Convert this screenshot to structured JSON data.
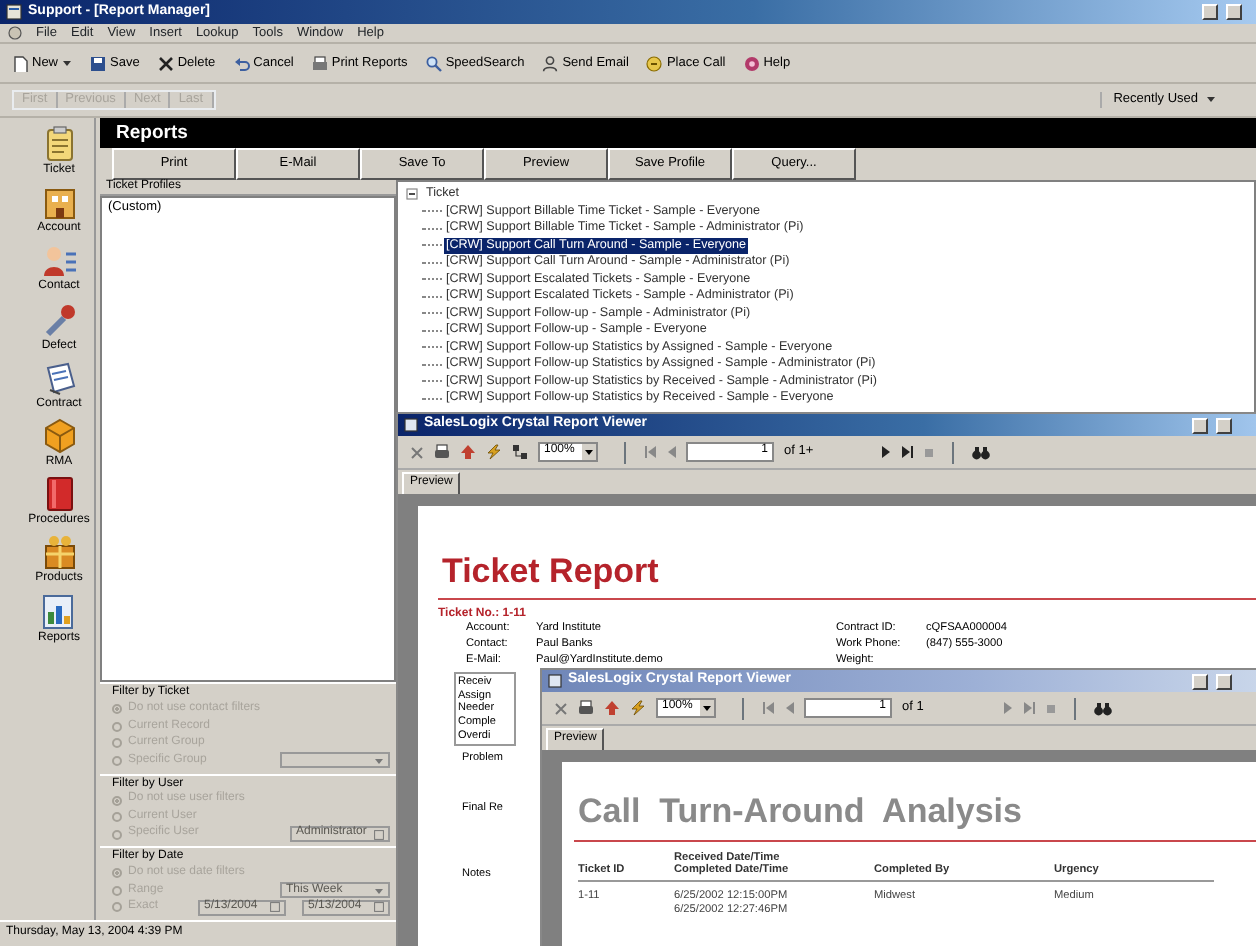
{
  "window": {
    "title": "Support - [Report Manager]"
  },
  "menu": [
    "File",
    "Edit",
    "View",
    "Insert",
    "Lookup",
    "Tools",
    "Window",
    "Help"
  ],
  "toolbar": [
    {
      "label": "New",
      "kind": "new",
      "dropdown": true
    },
    {
      "label": "Save",
      "kind": "save",
      "dropdown": false
    },
    {
      "label": "Delete",
      "kind": "delete",
      "dropdown": false
    },
    {
      "label": "Cancel",
      "kind": "cancel",
      "dropdown": false
    },
    {
      "label": "Print Reports",
      "kind": "print",
      "dropdown": false
    },
    {
      "label": "SpeedSearch",
      "kind": "search",
      "dropdown": false
    },
    {
      "label": "Send Email",
      "kind": "email",
      "dropdown": false
    },
    {
      "label": "Place Call",
      "kind": "call",
      "dropdown": false
    },
    {
      "label": "Help",
      "kind": "help",
      "dropdown": false
    }
  ],
  "record_nav": {
    "buttons": [
      {
        "label": "First",
        "disabled": true
      },
      {
        "label": "Previous",
        "disabled": true
      },
      {
        "label": "Next",
        "disabled": true
      },
      {
        "label": "Last",
        "disabled": true
      }
    ],
    "recently_used": "Recently Used"
  },
  "sidebar": {
    "items": [
      {
        "label": "Ticket",
        "kind": "ticket"
      },
      {
        "label": "Account",
        "kind": "account"
      },
      {
        "label": "Contact",
        "kind": "contact"
      },
      {
        "label": "Defect",
        "kind": "defect"
      },
      {
        "label": "Contract",
        "kind": "contract"
      },
      {
        "label": "RMA",
        "kind": "rma"
      },
      {
        "label": "Procedures",
        "kind": "procedures"
      },
      {
        "label": "Products",
        "kind": "products"
      },
      {
        "label": "Reports",
        "kind": "reports"
      }
    ]
  },
  "reports": {
    "title": "Reports",
    "buttons": [
      "Print",
      "E-Mail",
      "Save To",
      "Preview",
      "Save Profile",
      "Query..."
    ],
    "profiles": {
      "header": "Ticket Profiles",
      "items": [
        "(Custom)"
      ]
    },
    "filters": [
      {
        "title": "Filter by Ticket",
        "options": [
          {
            "label": "Do not use contact filters",
            "selected": true,
            "disabled": true
          },
          {
            "label": "Current Record",
            "selected": false,
            "disabled": true
          },
          {
            "label": "Current Group",
            "selected": false,
            "disabled": true
          },
          {
            "label": "Specific Group",
            "selected": false,
            "disabled": true,
            "fields": [
              {
                "kind": "combo"
              }
            ]
          }
        ]
      },
      {
        "title": "Filter by User",
        "options": [
          {
            "label": "Do not use user filters",
            "selected": true,
            "disabled": true
          },
          {
            "label": "Current User",
            "selected": false,
            "disabled": true
          },
          {
            "label": "Specific User",
            "selected": false,
            "disabled": true,
            "fields": [
              {
                "kind": "lookup",
                "value": "Administrator"
              }
            ]
          }
        ]
      },
      {
        "title": "Filter by Date",
        "options": [
          {
            "label": "Do not use date filters",
            "selected": true,
            "disabled": true
          },
          {
            "label": "Range",
            "selected": false,
            "disabled": true,
            "fields": [
              {
                "kind": "combo",
                "value": "This Week"
              }
            ]
          },
          {
            "label": "Exact",
            "selected": false,
            "disabled": true,
            "fields": [
              {
                "kind": "date",
                "value": "5/13/2004"
              },
              {
                "kind": "date",
                "value": "5/13/2004"
              }
            ]
          }
        ]
      }
    ],
    "tree": {
      "label": "Ticket",
      "expanded": true,
      "children": [
        {
          "label": "[CRW] Support Billable Time Ticket - Sample - Everyone",
          "selected": false
        },
        {
          "label": "[CRW] Support Billable Time Ticket - Sample - Administrator (Pi)",
          "selected": false
        },
        {
          "label": "[CRW] Support Call Turn Around - Sample - Everyone",
          "selected": true
        },
        {
          "label": "[CRW] Support Call Turn Around - Sample - Administrator (Pi)",
          "selected": false
        },
        {
          "label": "[CRW] Support Escalated Tickets - Sample - Everyone",
          "selected": false
        },
        {
          "label": "[CRW] Support Escalated Tickets - Sample - Administrator (Pi)",
          "selected": false
        },
        {
          "label": "[CRW] Support Follow-up - Sample - Administrator (Pi)",
          "selected": false
        },
        {
          "label": "[CRW] Support Follow-up - Sample - Everyone",
          "selected": false
        },
        {
          "label": "[CRW] Support Follow-up Statistics by Assigned - Sample - Everyone",
          "selected": false
        },
        {
          "label": "[CRW] Support Follow-up Statistics by Assigned - Sample - Administrator (Pi)",
          "selected": false
        },
        {
          "label": "[CRW] Support Follow-up Statistics by Received - Sample - Administrator (Pi)",
          "selected": false
        },
        {
          "label": "[CRW] Support Follow-up Statistics by Received - Sample - Everyone",
          "selected": false
        }
      ]
    }
  },
  "viewers": [
    {
      "title": "SalesLogix Crystal Report Viewer",
      "active": true,
      "zoom": "100%",
      "page": "1",
      "page_count": "of 1+",
      "tab": "Preview",
      "report": {
        "kind": "ticket",
        "title": "Ticket Report",
        "ticket_label": "Ticket No.:",
        "ticket_no": "1-11",
        "fields_left": [
          {
            "label": "Account:",
            "value": "Yard Institute"
          },
          {
            "label": "Contact:",
            "value": "Paul Banks"
          },
          {
            "label": "E-Mail:",
            "value": "Paul@YardInstitute.demo"
          }
        ],
        "fields_right": [
          {
            "label": "Contract ID:",
            "value": "cQFSAA000004"
          },
          {
            "label": "Work Phone:",
            "value": "(847) 555-3000"
          },
          {
            "label": "Weight:"
          }
        ],
        "status_labels": [
          "Receiv",
          "Assign",
          "Needer",
          "Comple",
          "Overdi"
        ],
        "sections": [
          "Problem",
          "Final Re",
          "Notes"
        ]
      }
    },
    {
      "title": "SalesLogix Crystal Report Viewer",
      "active": false,
      "zoom": "100%",
      "page": "1",
      "page_count": "of 1",
      "tab": "Preview",
      "report": {
        "kind": "analysis",
        "title": "Call  Turn-Around  Analysis",
        "columns": [
          {
            "lines": [
              "Ticket ID"
            ]
          },
          {
            "lines": [
              "Received Date/Time",
              "Completed Date/Time"
            ]
          },
          {
            "lines": [
              "Completed By"
            ]
          },
          {
            "lines": [
              "Urgency"
            ]
          }
        ],
        "rows": [
          [
            {
              "lines": [
                "1-11"
              ]
            },
            {
              "lines": [
                "6/25/2002 12:15:00PM",
                "6/25/2002 12:27:46PM"
              ]
            },
            {
              "lines": [
                "Midwest"
              ]
            },
            {
              "lines": [
                "Medium"
              ]
            }
          ]
        ]
      }
    }
  ],
  "status_bar": "Thursday, May 13, 2004 4:39 PM"
}
